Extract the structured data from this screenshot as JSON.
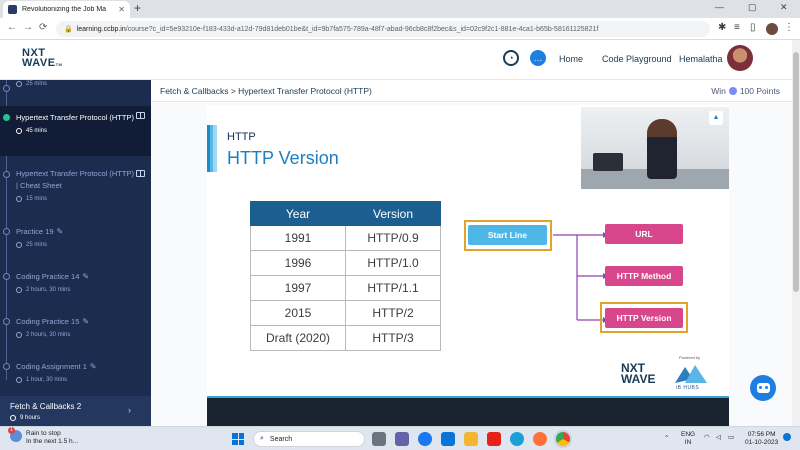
{
  "browser": {
    "tab_title": "Revolutionizing the Job Ma",
    "url_host": "learning.ccbp.in",
    "url_path": "/course?c_id=5e93210e-f183-433d-a12d-79d81deb01be&t_id=9b7fa575-789a-48f7-abad-96cb8c8f2bec&s_id=02c9f2c1-881e-4ca1-b65b-58161125821f",
    "back": "←",
    "forward": "→",
    "reload": "⟳",
    "new_tab": "+",
    "minimize": "—",
    "maximize": "▢",
    "close": "✕",
    "menu": "⋮"
  },
  "header": {
    "logo_line1": "NXT",
    "logo_line2": "WAVE",
    "logo_tm": "TM",
    "nav": [
      "Home",
      "Code Playground"
    ],
    "user_name": "Hemalatha"
  },
  "sidebar": {
    "first_meta": "25 mins",
    "items": [
      {
        "title": "Hypertext Transfer Protocol (HTTP)",
        "meta": "45 mins",
        "active": true
      },
      {
        "title": "Hypertext Transfer Protocol (HTTP) | Cheat Sheet",
        "meta": "15 mins"
      },
      {
        "title": "Practice 19",
        "meta": "25 mins"
      },
      {
        "title": "Coding Practice 14",
        "meta": "2 hours, 30 mins"
      },
      {
        "title": "Coding Practice 15",
        "meta": "2 hours, 30 mins"
      },
      {
        "title": "Coding Assignment 1",
        "meta": "1 hour, 30 mins"
      }
    ],
    "module": {
      "title": "Fetch & Callbacks 2",
      "meta": "9 hours"
    }
  },
  "content": {
    "breadcrumb": "Fetch & Callbacks > Hypertext Transfer Protocol (HTTP)",
    "win_label": "Win",
    "points": "100 Points"
  },
  "slide": {
    "subtitle": "HTTP",
    "title": "HTTP Version",
    "table": {
      "headers": [
        "Year",
        "Version"
      ],
      "rows": [
        [
          "1991",
          "HTTP/0.9"
        ],
        [
          "1996",
          "HTTP/1.0"
        ],
        [
          "1997",
          "HTTP/1.1"
        ],
        [
          "2015",
          "HTTP/2"
        ],
        [
          "Draft (2020)",
          "HTTP/3"
        ]
      ]
    },
    "diagram": {
      "start": "Start Line",
      "targets": [
        "URL",
        "HTTP Method",
        "HTTP Version"
      ]
    },
    "brand_line1": "NXT",
    "brand_line2": "WAVE",
    "powered_by": "Powered by",
    "ib_hubs": "iB HUBS",
    "colors": {
      "accent": "#1f7ec2",
      "table_header": "#1b5e8f",
      "pink": "#d8468b",
      "highlight": "#e0a42b",
      "start": "#4fb7e6"
    }
  },
  "taskbar": {
    "weather_line1": "Rain to stop",
    "weather_line2": "In the next 1.5 h...",
    "search": "Search",
    "lang_line1": "ENG",
    "lang_line2": "IN",
    "time": "07:56 PM",
    "date": "01-10-2023"
  }
}
